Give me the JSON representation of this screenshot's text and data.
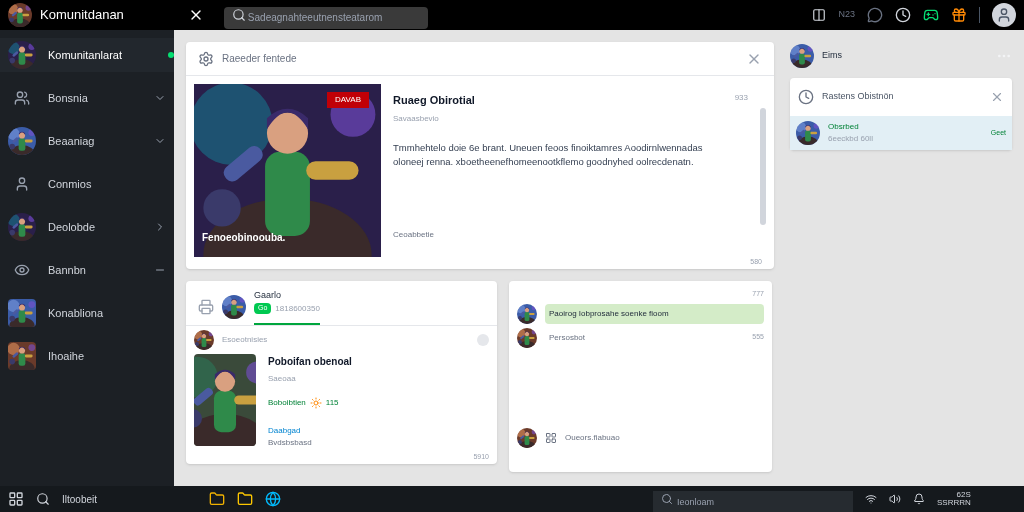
{
  "top_bar": {
    "title": "Komunitdanan",
    "search": {
      "placeholder": "Sadeagnahteeutnensteatarom"
    },
    "counter": "N23"
  },
  "sidebar": {
    "items": [
      {
        "label": "Komunitanlarat",
        "kind": "avatar",
        "selected": true
      },
      {
        "label": "Bonsnia",
        "kind": "icon",
        "selected": false,
        "trailing": {
          "kind": "down"
        }
      },
      {
        "label": "Beaaniag",
        "kind": "avatar",
        "selected": false,
        "trailing": {
          "kind": "down"
        }
      },
      {
        "label": "Conmios",
        "kind": "icon",
        "selected": false
      },
      {
        "label": "Deolobde",
        "kind": "avatar",
        "selected": false,
        "trailing": {
          "kind": "right"
        }
      },
      {
        "label": "Bannbn",
        "kind": "icon",
        "selected": false,
        "trailing": {
          "kind": "dash"
        }
      },
      {
        "label": "Konabliona",
        "kind": "avatar",
        "selected": false
      },
      {
        "label": "Ihoaihe",
        "kind": "avatar",
        "selected": false
      }
    ]
  },
  "featured": {
    "header": "Raeeder fentede",
    "ribbon": "DAVAB",
    "caption": "Fenoeobinoouba.",
    "title": "Ruaeg Obirotial",
    "meta": "Savaasbevio",
    "body": "Tmmhehtelo doie 6e brant. Uneuen feoos finoiktamres Aoodirnlwennadas oloneej renna. xboetheenefhomeenootkflemo goodnyhed oolrecdenatn.",
    "footer": "Ceoabbetie",
    "time": "933",
    "count": "580"
  },
  "post_card": {
    "author": "Gaarlo",
    "badge": "Go",
    "meta": "1818600350",
    "post": {
      "author": "Esoeotnisies",
      "title": "Poboifan obenoal",
      "meta": "Saeoaa",
      "reactions": "Boboibtien",
      "reaction_count": "115",
      "link": "Daabgad",
      "footer": "Bvdsbsbasd"
    },
    "count": "5910"
  },
  "chat_card": {
    "time": "777",
    "messages": [
      {
        "text": "Paoirog Iobprosahe soenke fioom",
        "highlighted": true
      },
      {
        "text": "Persosbot",
        "time": "555",
        "highlighted": false
      }
    ],
    "bottom": "Oueors.fiabuao"
  },
  "right_panel": {
    "user": "Eims",
    "notification": {
      "title": "Rastens Obistnön",
      "item_title": "Obsrbed",
      "item_meta": "6eeckbd 60ll",
      "action": "Geet"
    }
  },
  "taskbar": {
    "search": "Iltoobeit",
    "center_search": {
      "placeholder": "Ieonloam"
    },
    "time": "62S",
    "date": "SSRRRN"
  }
}
